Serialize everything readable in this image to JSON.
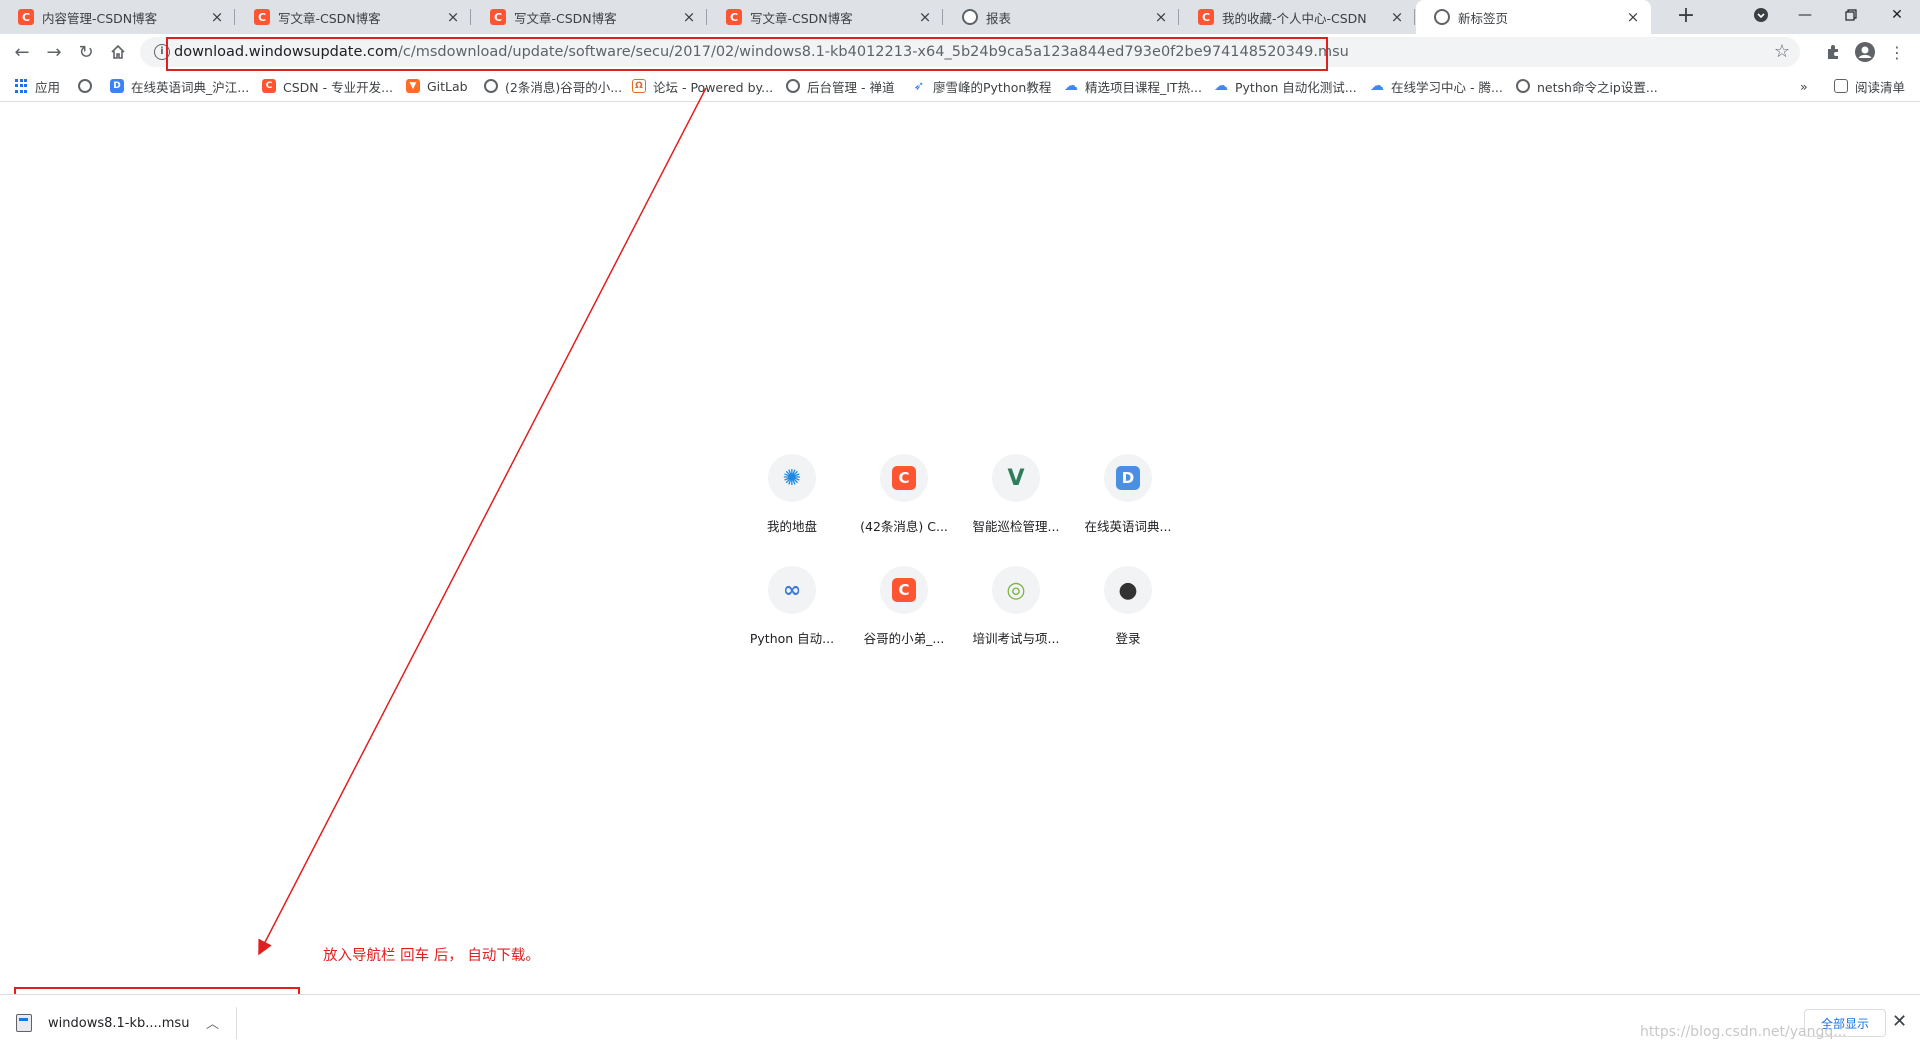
{
  "tabs": [
    {
      "title": "内容管理-CSDN博客",
      "favicon": "csdn-icon"
    },
    {
      "title": "写文章-CSDN博客",
      "favicon": "csdn-icon"
    },
    {
      "title": "写文章-CSDN博客",
      "favicon": "csdn-icon"
    },
    {
      "title": "写文章-CSDN博客",
      "favicon": "csdn-icon"
    },
    {
      "title": "报表",
      "favicon": "globe-icon"
    },
    {
      "title": "我的收藏-个人中心-CSDN",
      "favicon": "csdn-icon"
    },
    {
      "title": "新标签页",
      "favicon": "globe-icon",
      "active": true
    }
  ],
  "toolbar": {
    "url_host": "download.windowsupdate.com",
    "url_path": "/c/msdownload/update/software/secu/2017/02/windows8.1-kb4012213-x64_5b24b9ca5a123a844ed793e0f2be974148520349.msu"
  },
  "bookmarks": [
    {
      "label": "应用",
      "icon": "apps-icon"
    },
    {
      "label": "",
      "icon": "globe-icon"
    },
    {
      "label": "在线英语词典_沪江...",
      "icon": "dict-icon"
    },
    {
      "label": "CSDN - 专业开发...",
      "icon": "csdn-icon"
    },
    {
      "label": "GitLab",
      "icon": "gitlab-icon"
    },
    {
      "label": "(2条消息)谷哥的小...",
      "icon": "globe-icon"
    },
    {
      "label": "论坛 - Powered by...",
      "icon": "forum-icon"
    },
    {
      "label": "后台管理 - 禅道",
      "icon": "globe-icon"
    },
    {
      "label": "廖雪峰的Python教程",
      "icon": "rocket-icon"
    },
    {
      "label": "精选项目课程_IT热...",
      "icon": "cloud-icon"
    },
    {
      "label": "Python 自动化测试...",
      "icon": "cloud-icon"
    },
    {
      "label": "在线学习中心 - 腾...",
      "icon": "cloud-icon"
    },
    {
      "label": "netsh命令之ip设置...",
      "icon": "globe-icon"
    }
  ],
  "bookmarks_overflow": "»",
  "reading_list": "阅读清单",
  "shortcuts": [
    {
      "label": "我的地盘",
      "icon": "swirl-icon",
      "glyph": "✺",
      "color": "#1e88e5"
    },
    {
      "label": "(42条消息) C...",
      "icon": "csdn-icon",
      "glyph": "C",
      "color": "#fc5531"
    },
    {
      "label": "智能巡检管理...",
      "icon": "vue-icon",
      "glyph": "V",
      "color": "#2e7d5b"
    },
    {
      "label": "在线英语词典...",
      "icon": "dict-icon",
      "glyph": "D",
      "color": "#4a90e2"
    },
    {
      "label": "Python 自动...",
      "icon": "cloud-icon",
      "glyph": "∞",
      "color": "#3d7bd6"
    },
    {
      "label": "谷哥的小弟_...",
      "icon": "csdn-icon",
      "glyph": "C",
      "color": "#fc5531"
    },
    {
      "label": "培训考试与项...",
      "icon": "logo-icon",
      "glyph": "◎",
      "color": "#7cb342"
    },
    {
      "label": "登录",
      "icon": "camera-icon",
      "glyph": "●",
      "color": "#333333"
    }
  ],
  "annotation": {
    "text": "放入导航栏 回车 后， 自动下载。",
    "color": "#e02020"
  },
  "download": {
    "filename": "windows8.1-kb....msu",
    "show_all": "全部显示"
  },
  "watermark": "https://blog.csdn.net/yangq..."
}
